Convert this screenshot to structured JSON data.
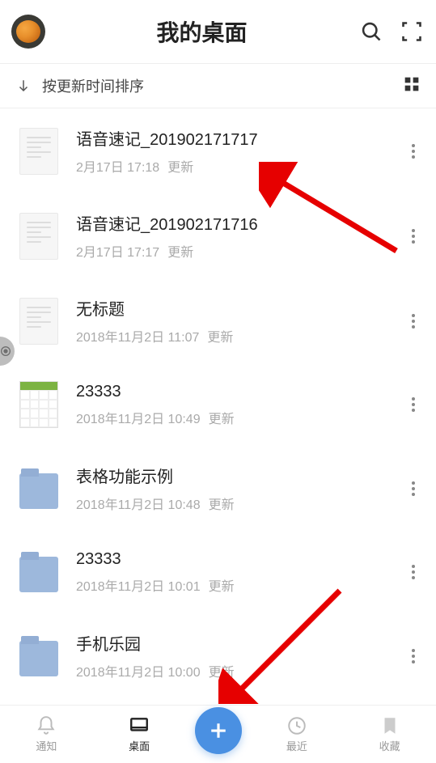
{
  "header": {
    "title": "我的桌面"
  },
  "sort": {
    "label": "按更新时间排序"
  },
  "files": [
    {
      "type": "doc",
      "title": "语音速记_201902171717",
      "date": "2月17日 17:18",
      "suffix": "更新"
    },
    {
      "type": "doc",
      "title": "语音速记_201902171716",
      "date": "2月17日 17:17",
      "suffix": "更新"
    },
    {
      "type": "doc",
      "title": "无标题",
      "date": "2018年11月2日 11:07",
      "suffix": "更新"
    },
    {
      "type": "sheet",
      "title": "23333",
      "date": "2018年11月2日 10:49",
      "suffix": "更新"
    },
    {
      "type": "folder",
      "title": "表格功能示例",
      "date": "2018年11月2日 10:48",
      "suffix": "更新"
    },
    {
      "type": "folder",
      "title": "23333",
      "date": "2018年11月2日 10:01",
      "suffix": "更新"
    },
    {
      "type": "folder",
      "title": "手机乐园",
      "date": "2018年11月2日 10:00",
      "suffix": "更新"
    }
  ],
  "nav": {
    "items": [
      {
        "label": "通知"
      },
      {
        "label": "桌面"
      },
      {
        "label": "最近"
      },
      {
        "label": "收藏"
      }
    ]
  }
}
